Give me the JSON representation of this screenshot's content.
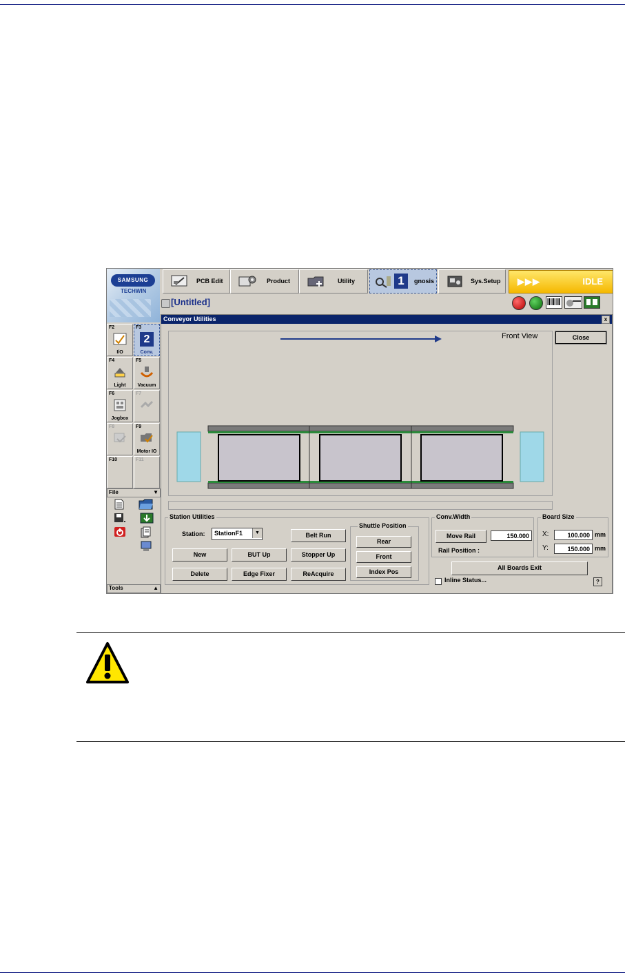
{
  "app": {
    "brand": "SAMSUNG",
    "brand_sub": "TECHWIN",
    "document_title": "[Untitled]",
    "status": "IDLE",
    "status_arrows": "▶▶▶"
  },
  "toolbar": [
    {
      "label": "PCB Edit",
      "icon": "pcb-edit-icon"
    },
    {
      "label": "Product",
      "icon": "product-icon"
    },
    {
      "label": "Utility",
      "icon": "utility-icon"
    },
    {
      "label": "gnosis",
      "icon": "diagnosis-icon",
      "callout": "1"
    },
    {
      "label": "Sys.Setup",
      "icon": "sys-setup-icon"
    }
  ],
  "function_keys": [
    {
      "key": "F2",
      "label": "I/O"
    },
    {
      "key": "F3",
      "label": "Conv.",
      "callout": "2"
    },
    {
      "key": "F4",
      "label": "Light"
    },
    {
      "key": "F5",
      "label": "Vacuum"
    },
    {
      "key": "F6",
      "label": "Jogbox"
    },
    {
      "key": "F7",
      "label": ""
    },
    {
      "key": "F8",
      "label": ""
    },
    {
      "key": "F9",
      "label": "Motor IO"
    },
    {
      "key": "F10",
      "label": ""
    },
    {
      "key": "F11",
      "label": ""
    }
  ],
  "file_bar": {
    "label": "File",
    "arrow": "▼"
  },
  "tools_bar": {
    "label": "Tools",
    "arrow": "▲"
  },
  "dialog": {
    "title": "Conveyor Utilities",
    "close_x": "x",
    "view_label": "Front View",
    "close_button": "Close",
    "station_utilities": {
      "title": "Station Utilities",
      "station_label": "Station:",
      "station_value": "StationF1",
      "buttons": {
        "belt_run": "Belt Run",
        "new": "New",
        "but_up": "BUT Up",
        "stopper_up": "Stopper Up",
        "delete": "Delete",
        "edge_fixer": "Edge Fixer",
        "reacquire": "ReAcquire"
      }
    },
    "shuttle_position": {
      "title": "Shuttle Position",
      "rear": "Rear",
      "front": "Front",
      "index_pos": "Index Pos"
    },
    "conv_width": {
      "title": "Conv.Width",
      "move_rail": "Move Rail",
      "width_value": "150.000",
      "rail_position_label": "Rail Position :"
    },
    "board_size": {
      "title": "Board Size",
      "x_label": "X:",
      "x_value": "100.000",
      "y_label": "Y:",
      "y_value": "150.000",
      "unit": "mm"
    },
    "all_boards_exit": "All Boards Exit",
    "inline_status": "Inline Status...",
    "help": "?"
  }
}
